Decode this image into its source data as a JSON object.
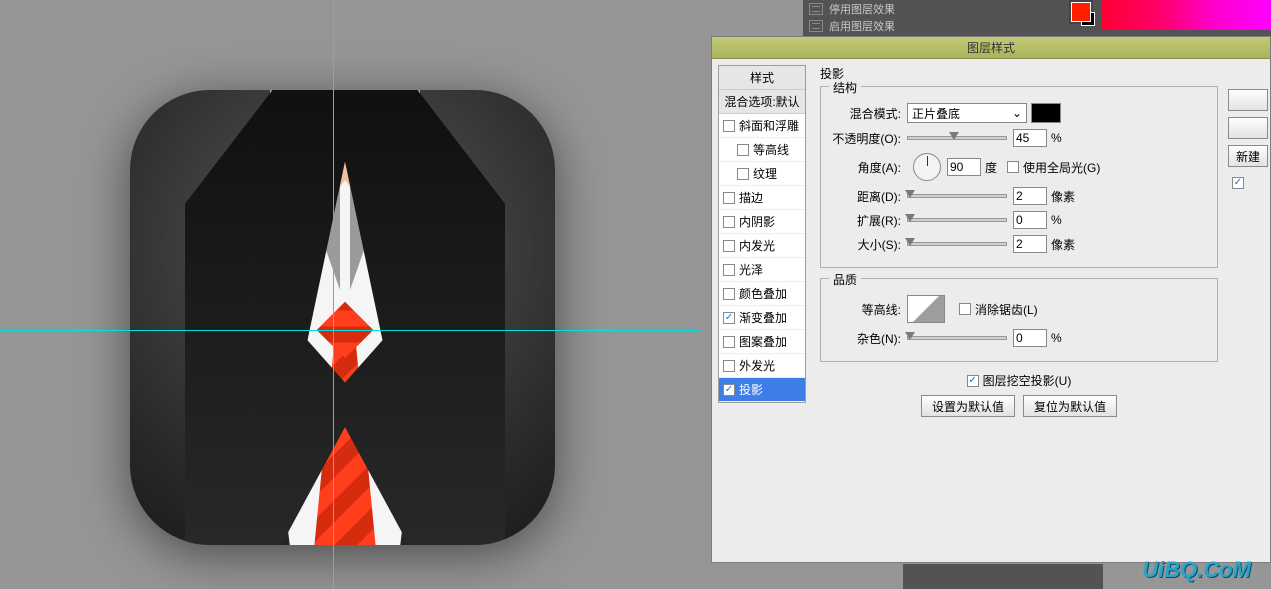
{
  "dark_panel": {
    "item_disable": "停用图层效果",
    "item_enable": "启用图层效果"
  },
  "dialog": {
    "title": "图层样式",
    "styles_header": "样式",
    "blend_options": "混合选项:默认",
    "effects": [
      {
        "label": "斜面和浮雕",
        "checked": false,
        "indent": false
      },
      {
        "label": "等高线",
        "checked": false,
        "indent": true
      },
      {
        "label": "纹理",
        "checked": false,
        "indent": true
      },
      {
        "label": "描边",
        "checked": false,
        "indent": false
      },
      {
        "label": "内阴影",
        "checked": false,
        "indent": false
      },
      {
        "label": "内发光",
        "checked": false,
        "indent": false
      },
      {
        "label": "光泽",
        "checked": false,
        "indent": false
      },
      {
        "label": "颜色叠加",
        "checked": false,
        "indent": false
      },
      {
        "label": "渐变叠加",
        "checked": true,
        "indent": false
      },
      {
        "label": "图案叠加",
        "checked": false,
        "indent": false
      },
      {
        "label": "外发光",
        "checked": false,
        "indent": false
      },
      {
        "label": "投影",
        "checked": true,
        "indent": false,
        "selected": true
      }
    ],
    "section_title": "投影",
    "group_struct": "结构",
    "blend_mode_label": "混合模式:",
    "blend_mode_value": "正片叠底",
    "opacity_label": "不透明度(O):",
    "opacity_value": "45",
    "opacity_unit": "%",
    "angle_label": "角度(A):",
    "angle_value": "90",
    "angle_unit": "度",
    "use_global": "使用全局光(G)",
    "distance_label": "距离(D):",
    "distance_value": "2",
    "distance_unit": "像素",
    "spread_label": "扩展(R):",
    "spread_value": "0",
    "spread_unit": "%",
    "size_label": "大小(S):",
    "size_value": "2",
    "size_unit": "像素",
    "group_quality": "品质",
    "contour_label": "等高线:",
    "antialias_label": "消除锯齿(L)",
    "noise_label": "杂色(N):",
    "noise_value": "0",
    "noise_unit": "%",
    "knockout_label": "图层挖空投影(U)",
    "btn_default": "设置为默认值",
    "btn_reset": "复位为默认值",
    "right_btn_top": " ",
    "right_btn_new": "新建"
  },
  "watermark": "UiBQ.CoM"
}
